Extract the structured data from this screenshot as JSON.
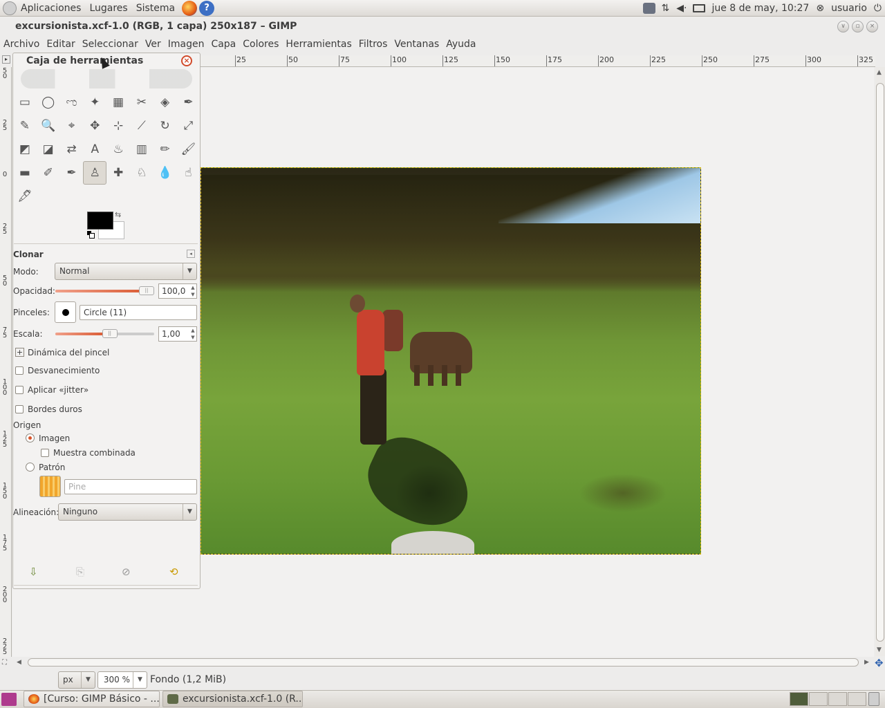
{
  "top_panel": {
    "menus": [
      "Aplicaciones",
      "Lugares",
      "Sistema"
    ],
    "date_time": "jue  8 de may, 10:27",
    "user": "usuario"
  },
  "window": {
    "title": "excursionista.xcf-1.0 (RGB, 1 capa) 250x187 – GIMP"
  },
  "menubar": [
    "Archivo",
    "Editar",
    "Seleccionar",
    "Ver",
    "Imagen",
    "Capa",
    "Colores",
    "Herramientas",
    "Filtros",
    "Ventanas",
    "Ayuda"
  ],
  "ruler": {
    "h_labels": [
      "25",
      "50",
      "75",
      "100",
      "125",
      "150",
      "175",
      "200",
      "225",
      "250",
      "275",
      "300",
      "325"
    ],
    "v_labels": [
      "5\n0",
      "2\n5",
      "0",
      "2\n5",
      "5\n0",
      "7\n5",
      "1\n0\n0",
      "1\n2\n5",
      "1\n5\n0",
      "1\n7\n5",
      "2\n0\n0",
      "2\n2\n5"
    ]
  },
  "toolbox": {
    "title": "Caja de herramientas",
    "tools": [
      "rect-select",
      "ellipse-select",
      "free-select",
      "fuzzy-select",
      "color-select",
      "scissors",
      "foreground-select",
      "paths",
      "color-picker",
      "zoom",
      "measure",
      "move",
      "align",
      "crop",
      "rotate",
      "scale",
      "shear",
      "perspective",
      "flip",
      "text",
      "bucket-fill",
      "blend",
      "pencil",
      "paintbrush",
      "eraser",
      "airbrush",
      "ink",
      "clone",
      "heal",
      "perspective-clone",
      "blur",
      "smudge",
      "dodge-burn"
    ],
    "tool_glyphs": [
      "▭",
      "◯",
      "ಌ",
      "✦",
      "▦",
      "✂",
      "◈",
      "✒",
      "✎",
      "🔍",
      "⌖",
      "✥",
      "⊹",
      "⟋",
      "↻",
      "⤢",
      "◩",
      "◪",
      "⇄",
      "A",
      "♨",
      "▥",
      "✏",
      "🖌",
      "▬",
      "✐",
      "✒",
      "♙",
      "✚",
      "♘",
      "💧",
      "☝",
      "🖋"
    ],
    "active_tool_index": 27,
    "tool_options": {
      "title": "Clonar",
      "mode_label": "Modo:",
      "mode_value": "Normal",
      "opacity_label": "Opacidad:",
      "opacity_value": "100,0",
      "opacity_fraction": 1.0,
      "brush_label": "Pinceles:",
      "brush_value": "Circle (11)",
      "scale_label": "Escala:",
      "scale_value": "1,00",
      "scale_fraction": 0.55,
      "brush_dynamics": "Dinámica del pincel",
      "fade": "Desvanecimiento",
      "jitter": "Aplicar «jitter»",
      "hard_edges": "Bordes duros",
      "source_label": "Origen",
      "source_image": "Imagen",
      "sample_merged": "Muestra combinada",
      "source_pattern": "Patrón",
      "pattern_value": "Pine",
      "alignment_label": "Alineación:",
      "alignment_value": "Ninguno"
    }
  },
  "statusbar": {
    "unit": "px",
    "zoom": "300 %",
    "layer_info": "Fondo (1,2 MiB)"
  },
  "taskbar": {
    "tasks": [
      "[Curso: GIMP Básico - ...",
      "excursionista.xcf-1.0 (R..."
    ]
  },
  "colors": {
    "accent": "#d8542b",
    "selection_border": "#d8b400",
    "foreground": "#000000",
    "background": "#ffffff"
  }
}
